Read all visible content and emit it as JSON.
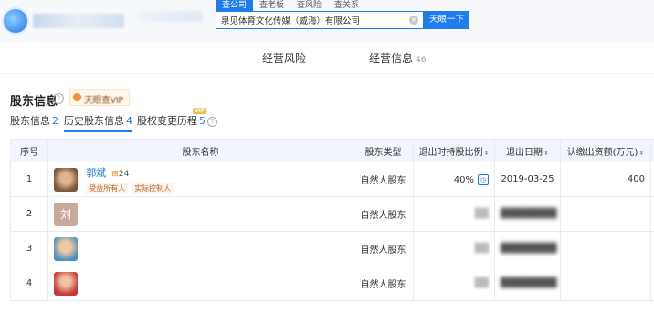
{
  "header": {
    "search_tabs": [
      "查公司",
      "查老板",
      "查风险",
      "查关系"
    ],
    "search_value": "泉见体育文化传媒（威海）有限公司",
    "search_button": "天眼一下"
  },
  "nav": {
    "risk_label": "经营风险",
    "info_label": "经营信息",
    "info_count": "46"
  },
  "section": {
    "title": "股东信息",
    "help": "?",
    "vip_badge": "VIP"
  },
  "subtabs": [
    {
      "label": "股东信息",
      "count": "2"
    },
    {
      "label": "历史股东信息",
      "count": "4"
    },
    {
      "label": "股权变更历程",
      "count": "5"
    }
  ],
  "table": {
    "headers": [
      "序号",
      "股东名称",
      "股东类型",
      "退出时持股比例",
      "退出日期",
      "认缴出资额(万元)",
      "认"
    ],
    "rows": [
      {
        "idx": "1",
        "name": "郭斌",
        "count": "24",
        "tags": [
          "受益所有人",
          "实际控制人"
        ],
        "type": "自然人股东",
        "pct": "40%",
        "date": "2019-03-25",
        "amount": "400"
      },
      {
        "idx": "2",
        "avatar_letter": "刘",
        "type": "自然人股东"
      },
      {
        "idx": "3",
        "type": "自然人股东"
      },
      {
        "idx": "4",
        "type": "自然人股东"
      }
    ]
  }
}
